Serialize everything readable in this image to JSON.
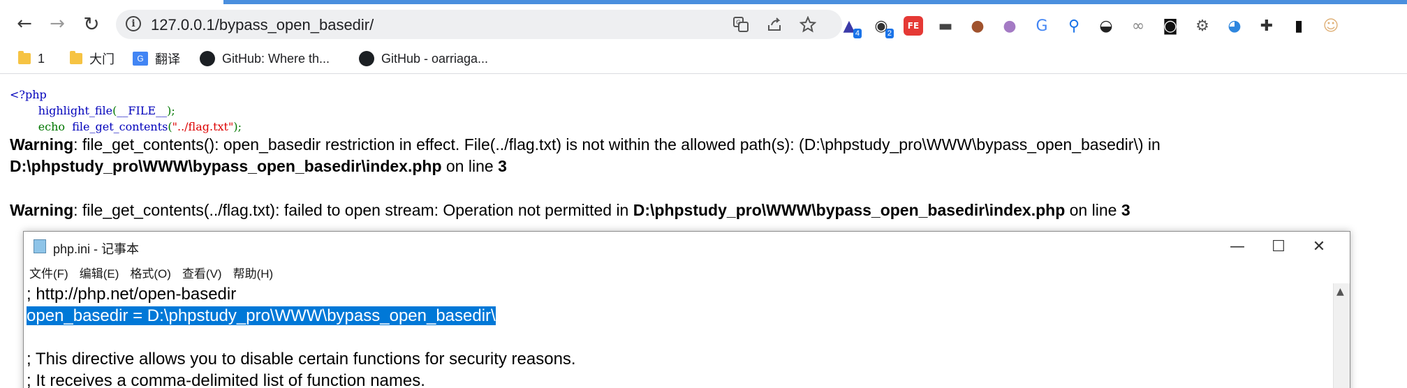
{
  "browser": {
    "url": "127.0.0.1/bypass_open_basedir/",
    "nav": {
      "back": "←",
      "forward": "→",
      "reload": "↻"
    },
    "omnibox_icons": [
      "translate-icon",
      "share-icon",
      "star-icon"
    ],
    "extensions": [
      {
        "name": "graduation-cap-extension-icon",
        "glyph": "▲",
        "badge": "4",
        "color": "#3b3aa8"
      },
      {
        "name": "panda-extension-icon",
        "glyph": "◉",
        "badge": "2",
        "color": "#333333"
      },
      {
        "name": "fe-extension-icon",
        "glyph": "FE",
        "badge": "",
        "color": "#e53935"
      },
      {
        "name": "mask-extension-icon",
        "glyph": "▬",
        "badge": "",
        "color": "#444444"
      },
      {
        "name": "cookie-extension-icon",
        "glyph": "●",
        "badge": "",
        "color": "#a0522d"
      },
      {
        "name": "circle-extension-icon",
        "glyph": "●",
        "badge": "",
        "color": "#a47ac4"
      },
      {
        "name": "translate-extension-icon",
        "glyph": "G",
        "badge": "",
        "color": "#4285f4"
      },
      {
        "name": "pin-extension-icon",
        "glyph": "⚲",
        "badge": "",
        "color": "#1a73e8"
      },
      {
        "name": "hat-extension-icon",
        "glyph": "◒",
        "badge": "",
        "color": "#222222"
      },
      {
        "name": "link-extension-icon",
        "glyph": "∞",
        "badge": "",
        "color": "#888888"
      },
      {
        "name": "glasses-extension-icon",
        "glyph": "◙",
        "badge": "",
        "color": "#111111"
      },
      {
        "name": "gear-extension-icon",
        "glyph": "⚙",
        "badge": "",
        "color": "#555555"
      },
      {
        "name": "globe-extension-icon",
        "glyph": "◕",
        "badge": "",
        "color": "#2e86de"
      },
      {
        "name": "puzzle-icon",
        "glyph": "✚",
        "badge": "",
        "color": "#333333"
      },
      {
        "name": "side-panel-icon",
        "glyph": "▮",
        "badge": "",
        "color": "#111111"
      },
      {
        "name": "profile-avatar",
        "glyph": "☺",
        "badge": "",
        "color": "#e0b27a"
      }
    ],
    "bookmarks": [
      {
        "label": "1",
        "icon": "folder-icon"
      },
      {
        "label": "大门",
        "icon": "folder-icon"
      },
      {
        "label": "翻译",
        "icon": "translate-icon"
      },
      {
        "label": "GitHub: Where th...",
        "icon": "github-icon"
      },
      {
        "label": "GitHub - oarriaga...",
        "icon": "github-icon"
      }
    ]
  },
  "page": {
    "code": {
      "open_tag": "<?php",
      "line1_fn": "highlight_file",
      "line1_paren_open": "(",
      "line1_arg": "__FILE__",
      "line1_paren_close": ");",
      "line2_kw": "echo",
      "line2_fn": "file_get_contents",
      "line2_paren_open": "(",
      "line2_arg": "\"../flag.txt\"",
      "line2_paren_close": ");"
    },
    "warning1": {
      "label": "Warning",
      "message": ": file_get_contents(): open_basedir restriction in effect. File(../flag.txt) is not within the allowed path(s): (D:\\phpstudy_pro\\WWW\\bypass_open_basedir\\) in",
      "file": "D:\\phpstudy_pro\\WWW\\bypass_open_basedir\\index.php",
      "on_line": " on line ",
      "line": "3"
    },
    "warning2": {
      "label": "Warning",
      "message": ": file_get_contents(../flag.txt): failed to open stream: Operation not permitted in ",
      "file": "D:\\phpstudy_pro\\WWW\\bypass_open_basedir\\index.php",
      "on_line": " on line ",
      "line": "3"
    }
  },
  "notepad": {
    "title": "php.ini - 记事本",
    "controls": {
      "minimize": "—",
      "maximize": "☐",
      "close": "✕"
    },
    "menu": [
      "文件(F)",
      "编辑(E)",
      "格式(O)",
      "查看(V)",
      "帮助(H)"
    ],
    "lines": [
      "; http://php.net/open-basedir",
      "open_basedir = D:\\phpstudy_pro\\WWW\\bypass_open_basedir\\",
      "",
      "; This directive allows you to disable certain functions for security reasons.",
      "; It receives a comma-delimited list of function names."
    ],
    "selected_line_index": 1
  }
}
